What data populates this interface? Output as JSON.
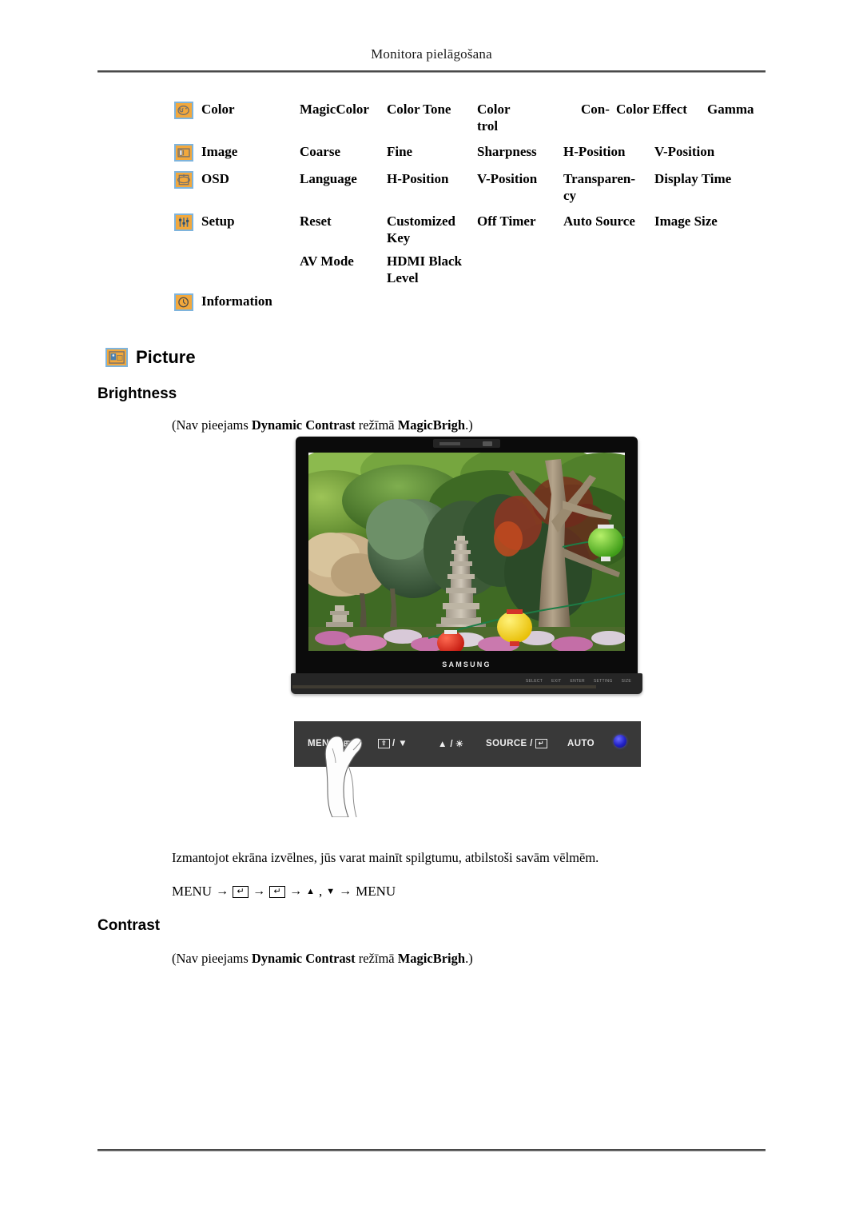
{
  "page": {
    "header_title": "Monitora pielāgošana"
  },
  "menu_table": {
    "rows": [
      {
        "icon": "palette-icon",
        "category": "Color",
        "items": [
          "MagicColor",
          "Color Tone",
          "Color Con-\ntrol",
          "Color Effect",
          "Gamma"
        ]
      },
      {
        "icon": "image-frame-icon",
        "category": "Image",
        "items": [
          "Coarse",
          "Fine",
          "Sharpness",
          "H-Position",
          "V-Position"
        ]
      },
      {
        "icon": "osd-icon",
        "category": "OSD",
        "items": [
          "Language",
          "H-Position",
          "V-Position",
          "Transparen-\ncy",
          "Display Time"
        ]
      },
      {
        "icon": "sliders-icon",
        "category": "Setup",
        "items": [
          "Reset",
          "Customized\nKey",
          "Off Timer",
          "Auto Source",
          "Image Size"
        ]
      },
      {
        "icon": "",
        "category": "",
        "items": [
          "AV Mode",
          "HDMI Black\nLevel",
          "",
          "",
          ""
        ]
      },
      {
        "icon": "clock-icon",
        "category": "Information",
        "items": [
          "",
          "",
          "",
          "",
          ""
        ]
      }
    ],
    "cells": {
      "r0c0": "MagicColor",
      "r0c1": "Color Tone",
      "r0c2": "Color Con-",
      "r0c2b": "trol",
      "r0c3": "Color Effect",
      "r0c4": "Gamma",
      "r1c0": "Coarse",
      "r1c1": "Fine",
      "r1c2": "Sharpness",
      "r1c3": "H-Position",
      "r1c4": "V-Position",
      "r2c0": "Language",
      "r2c1": "H-Position",
      "r2c2": "V-Position",
      "r2c3": "Transparen-",
      "r2c3b": "cy",
      "r2c4": "Display Time",
      "r3c0": "Reset",
      "r3c1": "Customized",
      "r3c1b": "Key",
      "r3c2": "Off Timer",
      "r3c3": "Auto Source",
      "r3c4": "Image Size",
      "r4c0": "AV Mode",
      "r4c1": "HDMI Black",
      "r4c1b": "Level"
    },
    "categories": {
      "color": "Color",
      "image": "Image",
      "osd": "OSD",
      "setup": "Setup",
      "information": "Information"
    },
    "split_cells": {
      "color_control_a": "Color",
      "color_control_b": "Con-",
      "color_control_c": "trol"
    }
  },
  "sections": {
    "picture_title": "Picture",
    "brightness_title": "Brightness",
    "contrast_title": "Contrast",
    "note": {
      "open_paren": "(Nav pieejams ",
      "bold1": "Dynamic Contrast",
      "middle": " režīmā ",
      "bold2": "MagicBrigh",
      "close_paren": ".)"
    },
    "body_paragraph": "Izmantojot ekrāna izvēlnes, jūs varat mainīt spilgtumu, atbilstoši savām vēlmēm.",
    "menu_path": {
      "start": "MENU",
      "arrow": "→",
      "enter_glyph": "↵",
      "up_glyph": "▲",
      "comma": ",",
      "down_glyph": "▼",
      "end": "MENU"
    }
  },
  "monitor": {
    "brand": "SAMSUNG",
    "stand_labels": [
      "SELECT",
      "EXIT",
      "ENTER",
      "SETTING",
      "SIZE"
    ]
  },
  "control_panel": {
    "menu_label": "MENU",
    "menu_alt": "/ ⊞",
    "down_glyph": "⇧",
    "down_label": "/ ▼",
    "up_label": "▲ /",
    "brightness_glyph": "☀",
    "source_label": "SOURCE /",
    "enter_glyph": "↵",
    "auto_label": "AUTO",
    "power_label": "power-button"
  },
  "colors": {
    "icon_fill": "#f2a83c",
    "icon_border": "#7eb4dd",
    "panel_bg": "#393939",
    "power_blue": "#2222c8"
  }
}
